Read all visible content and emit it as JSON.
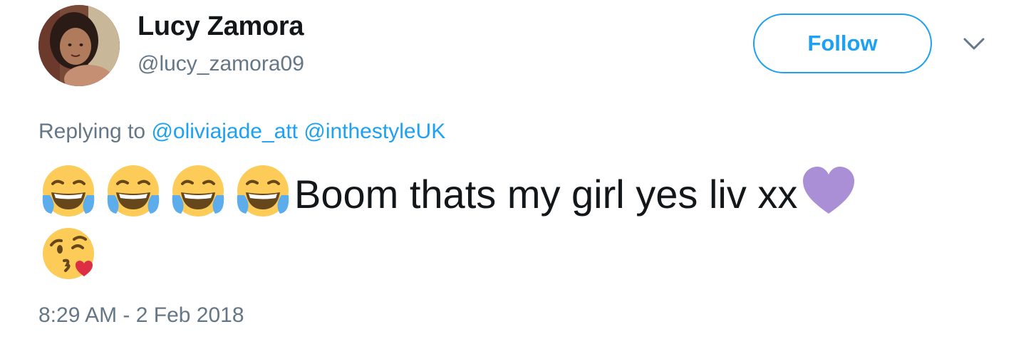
{
  "user": {
    "display_name": "Lucy Zamora",
    "handle": "@lucy_zamora09"
  },
  "follow_button": {
    "label": "Follow"
  },
  "menu": {
    "icon": "chevron-down-icon"
  },
  "reply": {
    "prefix": "Replying to",
    "mentions": [
      "@oliviajade_att",
      "@inthestyleUK"
    ]
  },
  "tweet": {
    "text": "Boom thats my girl yes liv xx",
    "leading_emojis": [
      "face-with-tears-of-joy-icon",
      "face-with-tears-of-joy-icon",
      "face-with-tears-of-joy-icon",
      "face-with-tears-of-joy-icon"
    ],
    "trailing_emojis": [
      "purple-heart-icon",
      "face-blowing-a-kiss-icon"
    ]
  },
  "timestamp": "8:29 AM - 2 Feb 2018",
  "colors": {
    "accent": "#1da1f2",
    "text_primary": "#14171a",
    "text_secondary": "#657786",
    "purple_heart": "#aa8ed6",
    "emoji_yellow": "#fdcb58"
  }
}
